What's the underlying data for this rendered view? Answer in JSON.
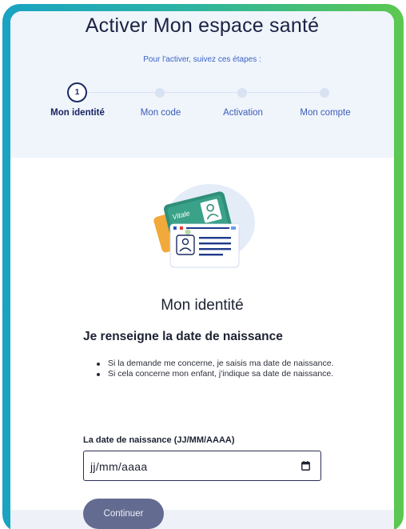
{
  "header": {
    "title": "Activer Mon espace santé",
    "subtitle": "Pour l'activer, suivez ces étapes :"
  },
  "stepper": {
    "active_number": "1",
    "steps": [
      {
        "label": "Mon identité",
        "active": true
      },
      {
        "label": "Mon code",
        "active": false
      },
      {
        "label": "Activation",
        "active": false
      },
      {
        "label": "Mon compte",
        "active": false
      }
    ]
  },
  "illustration": {
    "card_text": "Vitale",
    "icon": "id-cards-illustration"
  },
  "section": {
    "title": "Mon identité",
    "heading": "Je renseigne la date de naissance",
    "bullets": [
      "Si la demande me concerne, je saisis ma date de naissance.",
      "Si cela concerne mon enfant, j'indique sa date de naissance."
    ]
  },
  "birthdate": {
    "label": "La date de naissance (JJ/MM/AAAA)",
    "placeholder": "jj/mm/aaaa",
    "icon": "calendar-icon"
  },
  "actions": {
    "continue_label": "Continuer"
  },
  "colors": {
    "frame_gradient_start": "#1aa3c2",
    "frame_gradient_end": "#5bc84f",
    "header_background": "#eff5fb",
    "accent_blue": "#3d5bb8",
    "button_background": "#646b91"
  }
}
